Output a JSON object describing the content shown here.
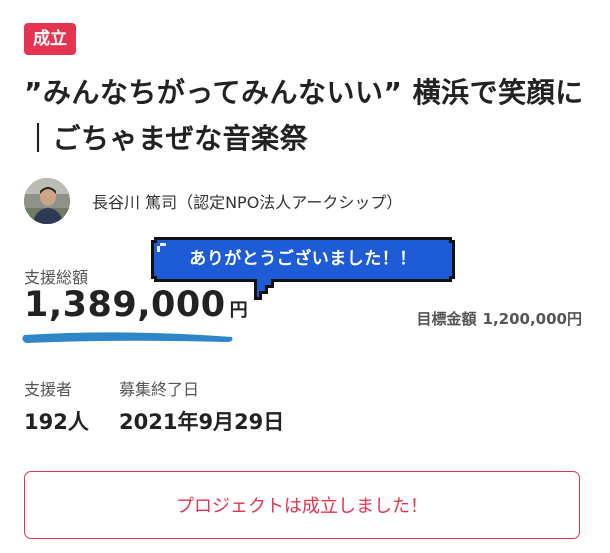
{
  "badge": {
    "label": "成立"
  },
  "project": {
    "title": "”みんなちがってみんないい” 横浜で笑顔に｜ごちゃまぜな音楽祭",
    "owner": "長谷川 篤司（認定NPO法人アークシップ）"
  },
  "funding": {
    "total_label": "支援総額",
    "total_value": "1,389,000",
    "total_unit": "円",
    "goal_label": "目標金額",
    "goal_value": "1,200,000円"
  },
  "thanks_bubble": {
    "text": "ありがとうございました！！"
  },
  "stats": {
    "supporters_label": "支援者",
    "supporters_value": "192人",
    "end_label": "募集終了日",
    "end_value": "2021年9月29日"
  },
  "status_button": {
    "label": "プロジェクトは成立しました！"
  },
  "colors": {
    "accent_red": "#e4344f",
    "bubble_blue": "#1e5bd6",
    "underline_blue": "#2e86c9"
  },
  "icons": {
    "avatar": "owner-avatar"
  }
}
